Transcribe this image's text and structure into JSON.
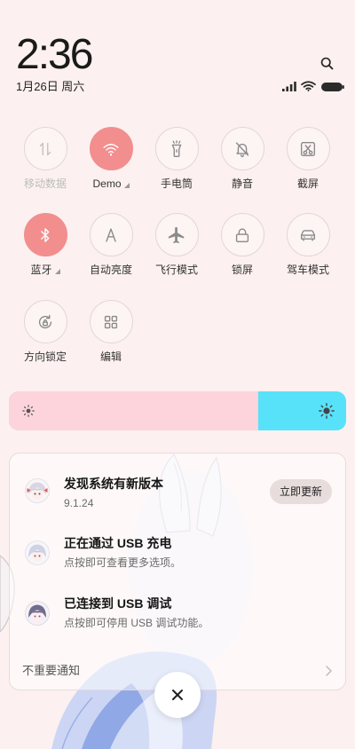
{
  "status_bar": {
    "time": "2:36",
    "date": "1月26日 周六",
    "search_icon": "search-icon",
    "indicators": [
      "signal-icon",
      "wifi-icon",
      "battery-icon"
    ]
  },
  "toggles": [
    {
      "label": "移动数据",
      "icon": "mobile-data-icon",
      "active": false,
      "disabled": true
    },
    {
      "label": "Demo",
      "icon": "wifi-icon",
      "active": true,
      "expandable": true
    },
    {
      "label": "手电筒",
      "icon": "flashlight-icon",
      "active": false
    },
    {
      "label": "静音",
      "icon": "mute-icon",
      "active": false
    },
    {
      "label": "截屏",
      "icon": "screenshot-icon",
      "active": false
    },
    {
      "label": "蓝牙",
      "icon": "bluetooth-icon",
      "active": true,
      "expandable": true
    },
    {
      "label": "自动亮度",
      "icon": "auto-brightness-icon",
      "active": false
    },
    {
      "label": "飞行模式",
      "icon": "airplane-icon",
      "active": false
    },
    {
      "label": "锁屏",
      "icon": "lock-icon",
      "active": false
    },
    {
      "label": "驾车模式",
      "icon": "car-icon",
      "active": false
    },
    {
      "label": "方向锁定",
      "icon": "rotation-lock-icon",
      "active": false
    },
    {
      "label": "编辑",
      "icon": "edit-icon",
      "active": false
    }
  ],
  "brightness": {
    "level": 0.74,
    "min_icon": "sun-small-icon",
    "max_icon": "sun-large-icon"
  },
  "notifications": [
    {
      "icon": "app-avatar-icon",
      "title": "发现系统有新版本",
      "text": "9.1.24",
      "action": "立即更新"
    },
    {
      "icon": "app-avatar-icon",
      "title": "正在通过 USB 充电",
      "text": "点按即可查看更多选项。"
    },
    {
      "icon": "app-avatar-icon",
      "title": "已连接到 USB 调试",
      "text": "点按即可停用 USB 调试功能。"
    }
  ],
  "unimportant_notifications": {
    "label": "不重要通知",
    "icon": "chevron-right-icon"
  },
  "close_button": {
    "icon": "close-icon"
  },
  "colors": {
    "background": "#fcf1f0",
    "toggle_active": "#f38e8e",
    "brightness_fill": "#fdd4db",
    "brightness_track": "#58e2f9"
  }
}
